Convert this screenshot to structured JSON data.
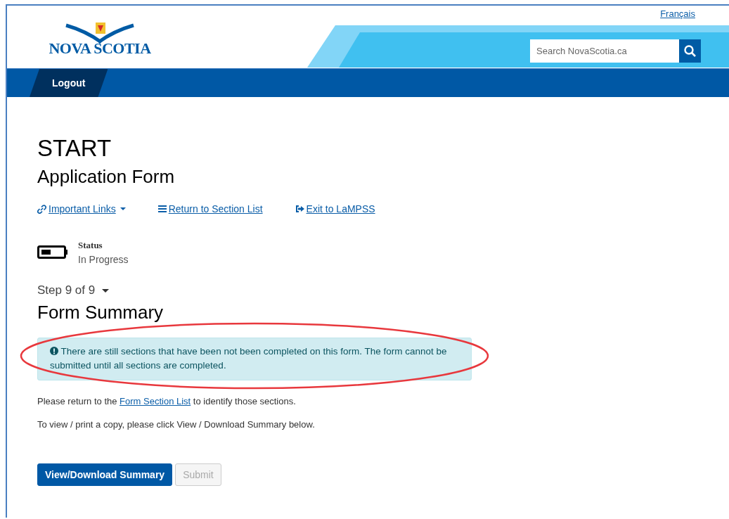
{
  "header": {
    "language_link": "Français",
    "logo_text": "NOVA SCOTIA",
    "search": {
      "placeholder": "Search NovaScotia.ca"
    }
  },
  "nav": {
    "items": [
      {
        "label": "Logout",
        "selected": true
      }
    ]
  },
  "page": {
    "title": "START",
    "subtitle": "Application Form",
    "links": [
      {
        "kind": "link",
        "label": "Important Links",
        "dropdown": true
      },
      {
        "kind": "list",
        "label": "Return to Section List",
        "dropdown": false
      },
      {
        "kind": "exit",
        "label": "Exit to LaMPSS",
        "dropdown": false
      }
    ],
    "status": {
      "label": "Status",
      "value": "In Progress"
    },
    "step": "Step 9 of 9",
    "section_title": "Form Summary",
    "alert": {
      "text": "There are still sections that have been not been completed on this form. The form cannot be submitted until all sections are completed.",
      "highlighted": true
    },
    "paragraphs": [
      {
        "before": "Please return to the ",
        "link": "Form Section List",
        "after": " to identify those sections."
      },
      {
        "before": "To view / print a copy, please click View / Download Summary below."
      }
    ],
    "buttons": [
      {
        "label": "View/Download Summary",
        "disabled": false
      },
      {
        "label": "Submit",
        "disabled": true
      }
    ]
  }
}
